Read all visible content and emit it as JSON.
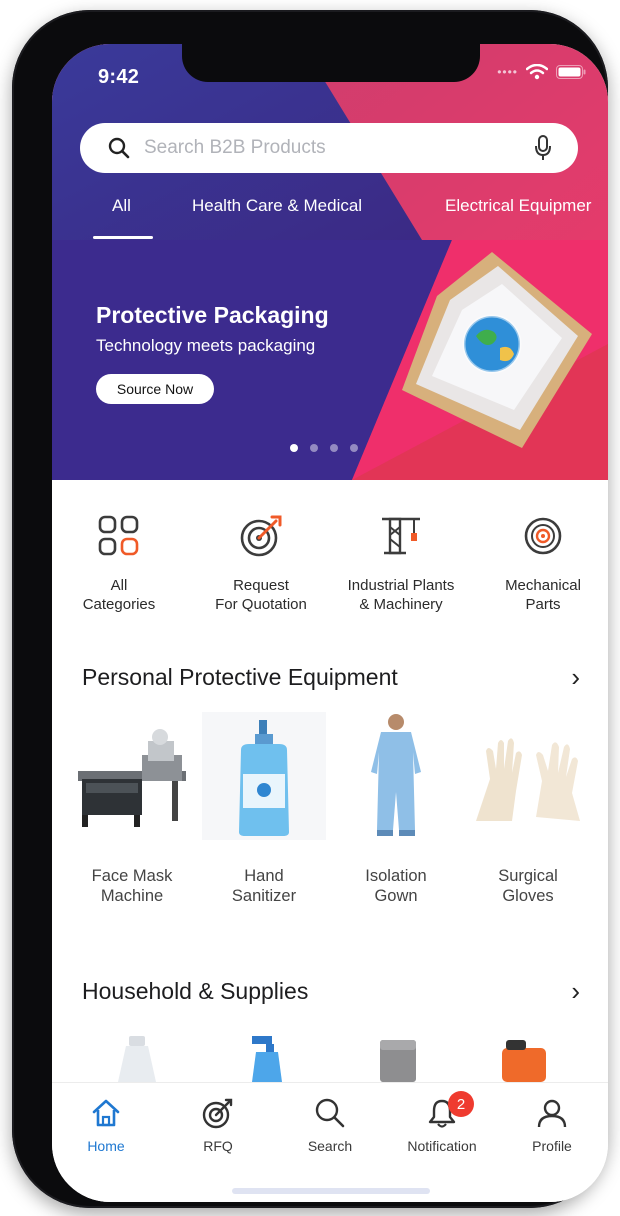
{
  "status": {
    "time": "9:42"
  },
  "search": {
    "placeholder": "Search B2B Products"
  },
  "tabs": [
    {
      "label": "All"
    },
    {
      "label": "Health Care & Medical"
    },
    {
      "label": "Electrical Equipmer"
    }
  ],
  "banner": {
    "title": "Protective Packaging",
    "subtitle": "Technology meets  packaging",
    "button": "Source Now",
    "slides": 4,
    "active_slide": 1
  },
  "categories": [
    {
      "line1": "All",
      "line2": "Categories",
      "icon": "grid-icon"
    },
    {
      "line1": "Request",
      "line2": "For Quotation",
      "icon": "target-icon"
    },
    {
      "line1": "Industrial Plants",
      "line2": "& Machinery",
      "icon": "crane-icon"
    },
    {
      "line1": "Mechanical",
      "line2": "Parts",
      "icon": "bearing-icon"
    }
  ],
  "ppe": {
    "title": "Personal Protective Equipment",
    "products": [
      {
        "line1": "Face Mask",
        "line2": "Machine"
      },
      {
        "line1": "Hand",
        "line2": "Sanitizer"
      },
      {
        "line1": "Isolation",
        "line2": "Gown"
      },
      {
        "line1": "Surgical",
        "line2": "Gloves"
      }
    ]
  },
  "household": {
    "title": "Household & Supplies"
  },
  "nav": [
    {
      "label": "Home",
      "icon": "home-icon",
      "active": true
    },
    {
      "label": "RFQ",
      "icon": "target-icon"
    },
    {
      "label": "Search",
      "icon": "search-icon"
    },
    {
      "label": "Notification",
      "icon": "bell-icon",
      "badge": "2"
    },
    {
      "label": "Profile",
      "icon": "user-icon"
    }
  ],
  "colors": {
    "hero_purple": "#3f2f8f",
    "hero_pink": "#e83a6f",
    "accent_blue": "#1f78d1",
    "icon_orange": "#f05a28",
    "badge_red": "#ef3b2f"
  }
}
